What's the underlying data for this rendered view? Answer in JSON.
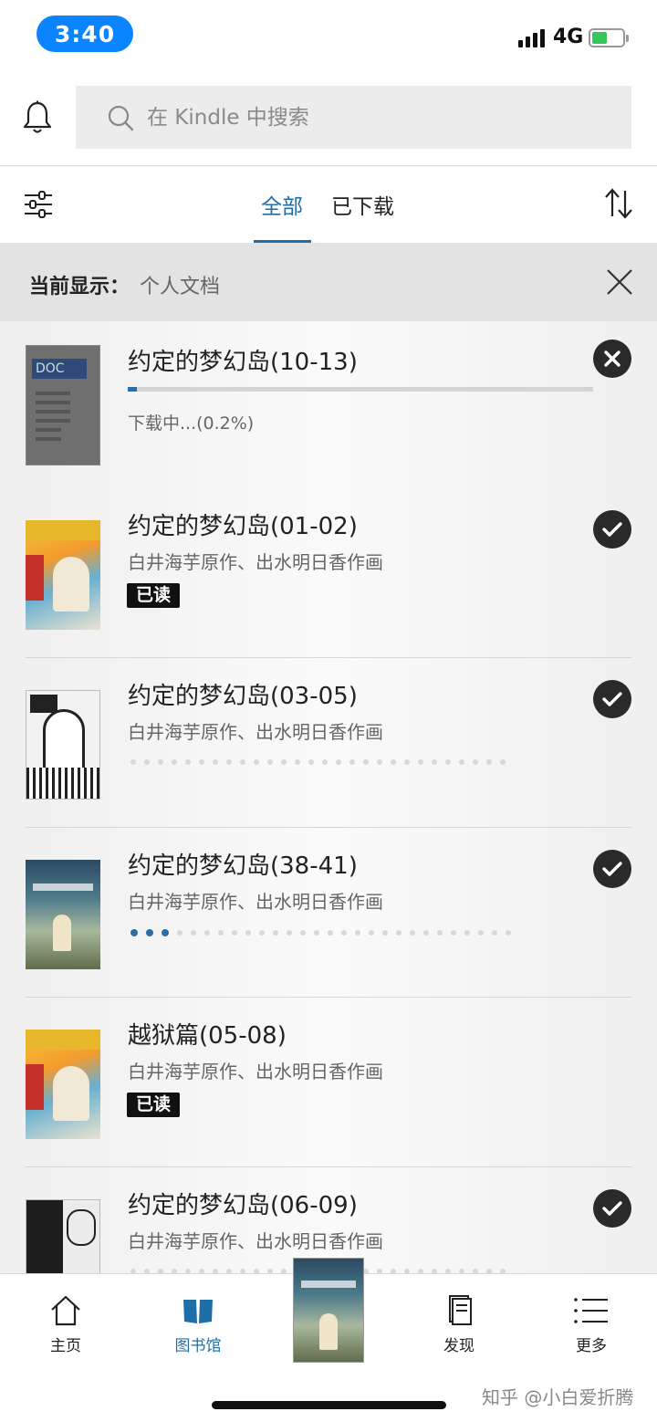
{
  "status_bar": {
    "time": "3:40",
    "network": "4G"
  },
  "search": {
    "placeholder": "在 Kindle 中搜索"
  },
  "tabs": {
    "all": "全部",
    "downloaded": "已下载"
  },
  "banner": {
    "label": "当前显示：",
    "value": "个人文档"
  },
  "downloading_item": {
    "title": "约定的梦幻岛(10-13)",
    "status": "下载中...(0.2%)",
    "progress": 0.02,
    "cover_label": "DOC"
  },
  "items": [
    {
      "title": "约定的梦幻岛(01-02)",
      "author": "白井海芋原作、出水明日香作画",
      "badge": "已读"
    },
    {
      "title": "约定的梦幻岛(03-05)",
      "author": "白井海芋原作、出水明日香作画",
      "read_progress_dots": 0
    },
    {
      "title": "约定的梦幻岛(38-41)",
      "author": "白井海芋原作、出水明日香作画",
      "read_progress_dots": 3
    },
    {
      "title": "越狱篇(05-08)",
      "author": "白井海芋原作、出水明日香作画",
      "badge": "已读"
    },
    {
      "title": "约定的梦幻岛(06-09)",
      "author": "白井海芋原作、出水明日香作画",
      "read_progress_dots": 0
    }
  ],
  "bottom_nav": {
    "home": "主页",
    "library": "图书馆",
    "discover": "发现",
    "more": "更多"
  },
  "watermark": "知乎 @小白爱折腾",
  "colors": {
    "accent": "#1f6ea8",
    "status_pill": "#0a84ff",
    "battery": "#34c759"
  },
  "icons": [
    "bell-icon",
    "search-icon",
    "filter-icon",
    "sort-icon",
    "close-icon",
    "check-icon",
    "cancel-icon",
    "home-icon",
    "library-icon",
    "discover-icon",
    "more-icon"
  ]
}
